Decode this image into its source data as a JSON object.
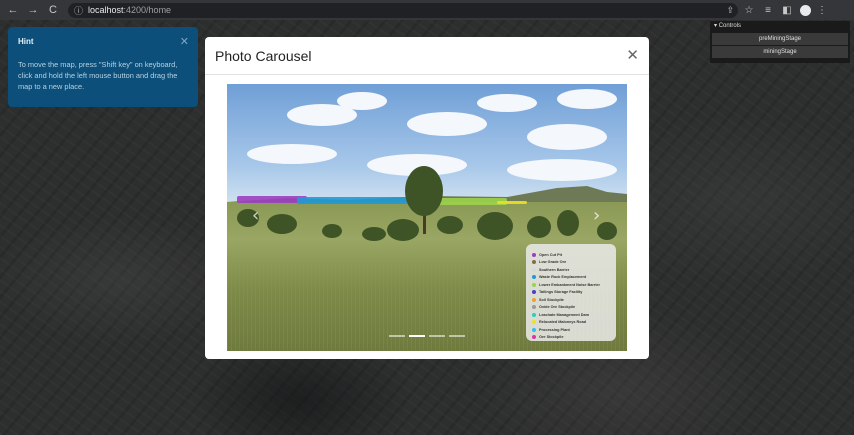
{
  "browser": {
    "url_host": "localhost",
    "url_path": ":4200/home",
    "nav": {
      "back": "←",
      "forward": "→",
      "reload": "C"
    }
  },
  "hint": {
    "title": "Hint",
    "close": "✕",
    "text": "To move the map, press \"Shift key\" on keyboard, click and hold the left mouse button and drag the map to a new place."
  },
  "controls": {
    "header": "Controls",
    "items": [
      "preMiningStage",
      "miningStage"
    ]
  },
  "modal": {
    "title": "Photo Carousel",
    "close": "✕",
    "prev": "‹",
    "next": "›",
    "slide_count": 4,
    "active_slide": 2
  },
  "legend": {
    "items": [
      {
        "label": "Open Cut Pit",
        "color": "#9b3fc0"
      },
      {
        "label": "Low Grade Ore",
        "color": "#8a6a4a"
      },
      {
        "label": "Southern Barrier",
        "color": "#d8d8d8"
      },
      {
        "label": "Waste Rock Emplacement",
        "color": "#1f9ad6"
      },
      {
        "label": "Lower Embankment Noise Barrier",
        "color": "#9bd34a"
      },
      {
        "label": "Tailings Storage Facility",
        "color": "#4a3fd0"
      },
      {
        "label": "Soil Stockpile",
        "color": "#f0a030"
      },
      {
        "label": "Oxide Ore Stockpile",
        "color": "#9a9a9a"
      },
      {
        "label": "Leachate Management Dam",
        "color": "#2ad0c0"
      },
      {
        "label": "Relocated Maloneys Road",
        "color": "#f0e020"
      },
      {
        "label": "Processing Plant",
        "color": "#30c0f0"
      },
      {
        "label": "Ore Stockpile",
        "color": "#e030b0"
      }
    ]
  }
}
